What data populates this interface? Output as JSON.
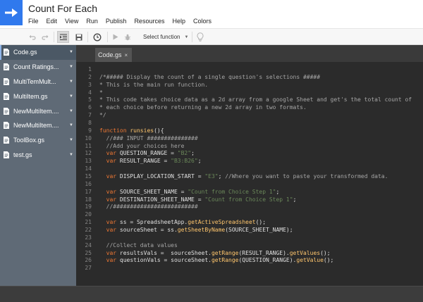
{
  "app": {
    "title": "Count For Each"
  },
  "menu": {
    "items": [
      "File",
      "Edit",
      "View",
      "Run",
      "Publish",
      "Resources",
      "Help",
      "Colors"
    ]
  },
  "toolbar": {
    "buttons": [
      "undo-icon",
      "redo-icon",
      "indent-icon",
      "save-icon",
      "trigger-clock-icon",
      "run-icon",
      "debug-bug-icon",
      "lightbulb-icon"
    ],
    "function_select": "Select function"
  },
  "sidebar": {
    "files": [
      {
        "name": "Code.gs",
        "active": true
      },
      {
        "name": "Count Ratings...",
        "active": false
      },
      {
        "name": "MultiTemMult...",
        "active": false
      },
      {
        "name": "MultiItem.gs",
        "active": false
      },
      {
        "name": "NewMultiItem....",
        "active": false
      },
      {
        "name": "NewMultiItem....",
        "active": false
      },
      {
        "name": "ToolBox.gs",
        "active": false
      },
      {
        "name": "test.gs",
        "active": false
      }
    ]
  },
  "editor": {
    "tab": {
      "label": "Code.gs",
      "close": "×"
    },
    "lines": [
      "",
      "/*##### Display the count of a single question's selections #####",
      "* This is the main run function.",
      "*",
      "* This code takes choice data as a 2d array from a google Sheet and get's the total count of",
      "* each choice before returning a new 2d array in two formats.",
      "*/",
      "",
      "function runsies(){",
      "  //### INPUT ###############",
      "  //Add your choices here",
      "  var QUESTION_RANGE = \"B2\";",
      "  var RESULT_RANGE = \"B3:B26\";",
      "",
      "  var DISPLAY_LOCATION_START = \"E3\"; //Where you want to paste your transformed data.",
      "",
      "  var SOURCE_SHEET_NAME = \"Count from Choice Step 1\";",
      "  var DESTINATION_SHEET_NAME = \"Count from Choice Step 1\";",
      "  //#########################",
      "",
      "  var ss = SpreadsheetApp.getActiveSpreadsheet();",
      "  var sourceSheet = ss.getSheetByName(SOURCE_SHEET_NAME);",
      "",
      "  //Collect data values",
      "  var resultsVals =  sourceSheet.getRange(RESULT_RANGE).getValues();",
      "  var questionVals = sourceSheet.getRange(QUESTION_RANGE).getValue();",
      ""
    ]
  },
  "colors": {
    "logo": "#3079ed",
    "sidebar": "#5f6a76",
    "editor_bg": "#2b2b2b",
    "keyword": "#f07833",
    "function": "#ffc66d",
    "string": "#6a8759",
    "comment": "#a6a6a6"
  }
}
